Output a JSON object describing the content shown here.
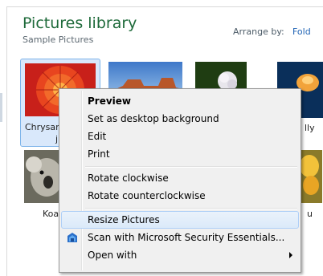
{
  "library": {
    "title": "Pictures library",
    "subtitle": "Sample Pictures",
    "arrange_label": "Arrange by:",
    "arrange_value": "Fold"
  },
  "thumbnails": [
    {
      "caption_line1": "Chrysan",
      "caption_line2": "jp",
      "selected": true,
      "icon": "chrysanthemum-thumbnail"
    },
    {
      "caption_line1": "",
      "selected": false,
      "icon": "desert-thumbnail"
    },
    {
      "caption_line1": "",
      "selected": false,
      "icon": "hydrangeas-thumbnail"
    },
    {
      "caption_line1": "lly",
      "selected": false,
      "icon": "jellyfish-thumbnail"
    },
    {
      "caption_line1": "Koa",
      "selected": false,
      "icon": "koala-thumbnail"
    },
    {
      "caption_line1": "u",
      "selected": false,
      "icon": "tulips-thumbnail"
    }
  ],
  "context_menu": {
    "items": [
      {
        "label": "Preview",
        "bold": true
      },
      {
        "label": "Set as desktop background"
      },
      {
        "label": "Edit"
      },
      {
        "label": "Print"
      },
      {
        "label": "Rotate clockwise"
      },
      {
        "label": "Rotate counterclockwise"
      },
      {
        "label": "Resize Pictures",
        "highlighted": true
      },
      {
        "label": "Scan with Microsoft Security Essentials...",
        "icon": "security-essentials-icon"
      },
      {
        "label": "Open with",
        "submenu": true
      }
    ]
  },
  "colors": {
    "title_green": "#1e6a3a",
    "link_blue": "#1f63b5",
    "selection_fill": "#d9e8fb",
    "selection_border": "#7eb4ea"
  }
}
